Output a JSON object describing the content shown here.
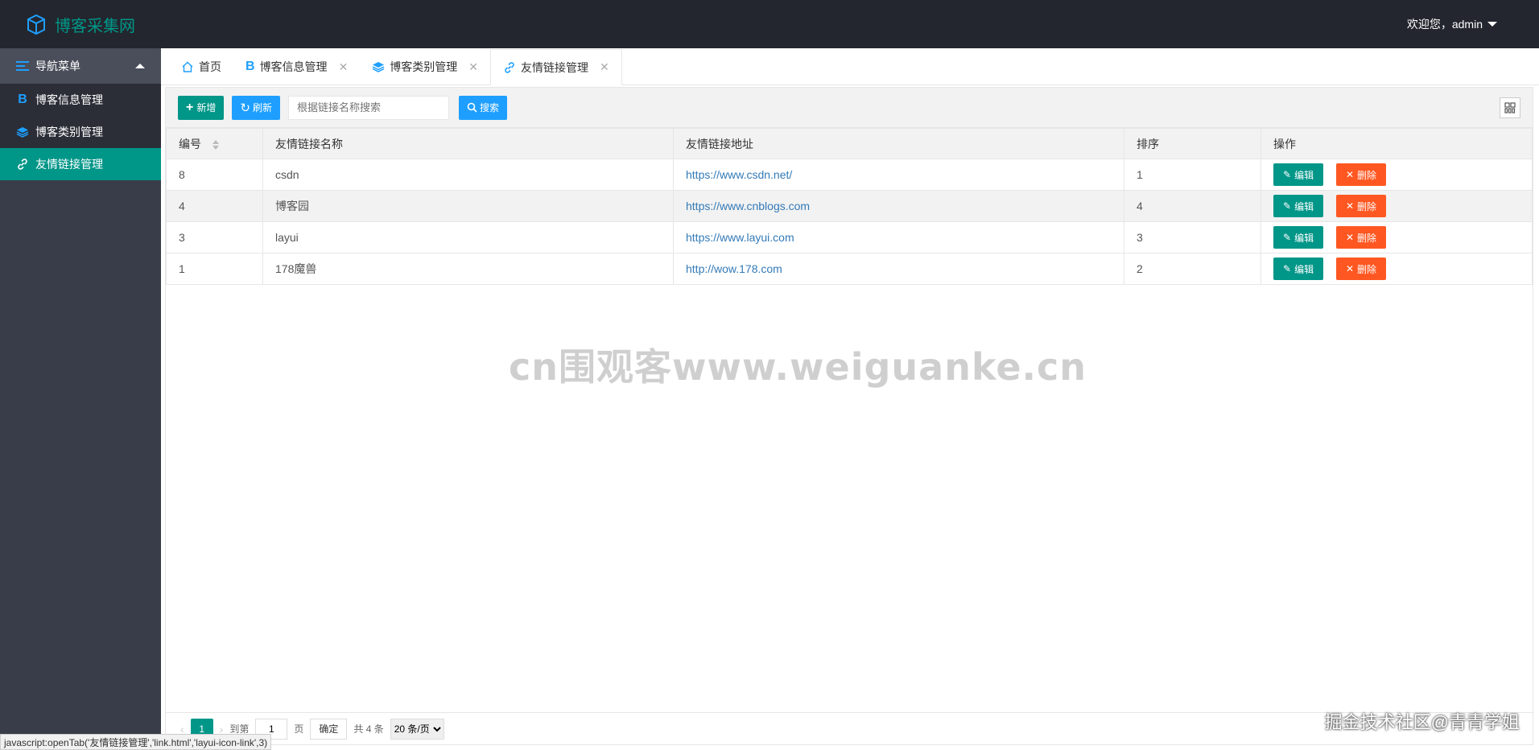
{
  "app": {
    "title": "博客采集网"
  },
  "header": {
    "welcome": "欢迎您，admin"
  },
  "sidebar": {
    "head": "导航菜单",
    "items": [
      {
        "label": "博客信息管理",
        "icon": "b-letter-icon"
      },
      {
        "label": "博客类别管理",
        "icon": "layers-icon"
      },
      {
        "label": "友情链接管理",
        "icon": "link-icon"
      }
    ]
  },
  "tabs": [
    {
      "label": "首页",
      "icon": "home-icon"
    },
    {
      "label": "博客信息管理",
      "icon": "b-letter-icon"
    },
    {
      "label": "博客类别管理",
      "icon": "layers-icon"
    },
    {
      "label": "友情链接管理",
      "icon": "link-icon"
    }
  ],
  "toolbar": {
    "add_label": "新增",
    "refresh_label": "刷新",
    "search_placeholder": "根据链接名称搜索",
    "search_label": "搜索"
  },
  "table": {
    "columns": [
      "编号",
      "友情链接名称",
      "友情链接地址",
      "排序",
      "操作"
    ],
    "rows": [
      {
        "id": "8",
        "name": "csdn",
        "url": "https://www.csdn.net/",
        "order": "1"
      },
      {
        "id": "4",
        "name": "博客园",
        "url": "https://www.cnblogs.com",
        "order": "4"
      },
      {
        "id": "3",
        "name": "layui",
        "url": "https://www.layui.com",
        "order": "3"
      },
      {
        "id": "1",
        "name": "178魔兽",
        "url": "http://wow.178.com",
        "order": "2"
      }
    ],
    "edit_label": "编辑",
    "delete_label": "删除"
  },
  "watermark": "cn围观客www.weiguanke.cn",
  "pager": {
    "current": "1",
    "goto_label": "到第",
    "goto_value": "1",
    "page_unit": "页",
    "confirm_label": "确定",
    "total": "共 4 条",
    "page_size": "20 条/页"
  },
  "statusbar": "javascript:openTab('友情链接管理','link.html','layui-icon-link',3)",
  "corner_mark": "掘金技术社区@青青学姐",
  "colors": {
    "accent": "#009688",
    "header_bg": "#23262e",
    "sidebar_bg": "#393d49",
    "primary": "#1e9fff",
    "danger": "#ff5722"
  }
}
